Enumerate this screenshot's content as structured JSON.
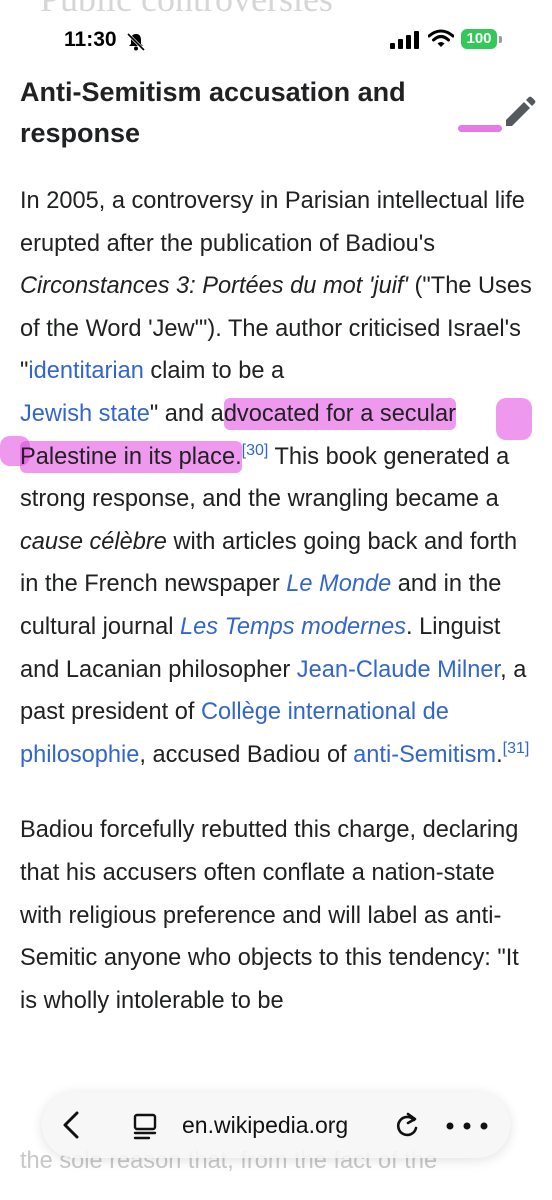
{
  "background_heading": "Public controversies",
  "status_bar": {
    "time": "11:30",
    "battery": "100",
    "icons": [
      "bell-slash-icon",
      "signal-icon",
      "wifi-icon",
      "battery-icon"
    ]
  },
  "section": {
    "title": "Anti-Semitism accusation and response",
    "edit_icon": "pencil-icon"
  },
  "para1": {
    "t1": "In 2005, a controversy in Parisian intellectual life erupted after the publication of Badiou's ",
    "book": "Circonstances 3: Portées du mot 'juif'",
    "t2": " (\"The Uses of the Word 'Jew'\"). The author criticised Israel's \"",
    "link_identitarian": "identitarian",
    "t3a": " claim to be a",
    "t3b": " ",
    "link_jewish_state": "Jewish state",
    "t4": "\" and a",
    "highlighted": "dvocated for a secular Palestine in its place.",
    "ref30": "[30]",
    "t5": " This book generated a strong response, and the wrangling became a ",
    "cause": "cause célèbre",
    "t6": " with articles going back and forth in the French newspaper ",
    "link_le_monde": "Le Monde",
    "t7": " and in the cultural journal ",
    "link_temps": "Les Temps modernes",
    "t8": ". Linguist and Lacanian philosopher ",
    "link_milner": "Jean-Claude Milner",
    "t9": ", a past president of ",
    "link_college": "Collège international de philosophie",
    "t10": ", accused Badiou of ",
    "link_antisemitism": "anti-Semitism",
    "t11": ".",
    "ref31": "[31]"
  },
  "para2": {
    "text": "Badiou forcefully rebutted this charge, declaring that his accusers often conflate a nation-state with religious preference and will label as anti-Semitic anyone who objects to this tendency: \"It is wholly intolerable to be"
  },
  "ghost_bottom": "the sole reason that, from the fact of the",
  "url_bar": {
    "url": "en.wikipedia.org",
    "icons": [
      "back-chevron-icon",
      "reader-icon",
      "reload-icon",
      "more-icon"
    ]
  },
  "colors": {
    "link": "#3366cc",
    "highlight": "#e046e0",
    "battery": "#34c759",
    "text": "#202122"
  }
}
